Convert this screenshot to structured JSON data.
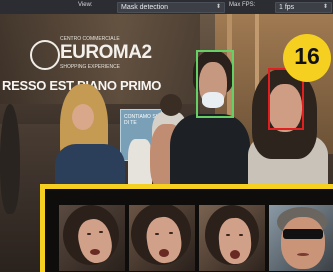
{
  "toolbar": {
    "view_label": "View:",
    "view_value": "Mask detection",
    "max_fps_label": "Max FPS:",
    "max_fps_value": "1 fps"
  },
  "scene": {
    "sign_small": "CENTRO COMMERCIALE",
    "sign_brand": "EUROMA2",
    "sign_sub": "SHOPPING EXPERIENCE",
    "promo_text": "RESSO EST PIANO PRIMO",
    "poster_text": "CONTIAMO SU DI TE"
  },
  "detections": [
    {
      "label": "with-mask",
      "color": "#66d066"
    },
    {
      "label": "no-mask",
      "color": "#e02020"
    }
  ],
  "badge": {
    "number": "16",
    "color": "#f5d020"
  },
  "thumbnail_strip": {
    "border_color": "#f5d020",
    "thumbnails": [
      {
        "type": "face-woman"
      },
      {
        "type": "face-woman"
      },
      {
        "type": "face-woman"
      },
      {
        "type": "face-man-sunglasses"
      }
    ]
  }
}
